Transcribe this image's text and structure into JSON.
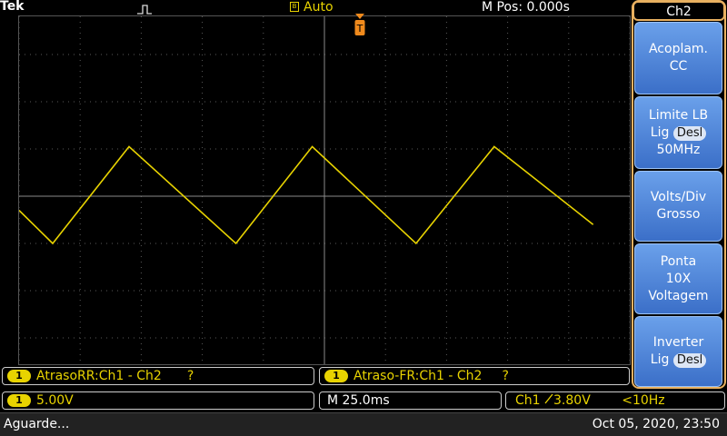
{
  "top_bar": {
    "brand": "Tek",
    "acquisition_mode": "Auto",
    "horizontal_position": "M Pos: 0.000s"
  },
  "side_menu": {
    "title": "Ch2",
    "coupling": {
      "line1": "Acoplam.",
      "line2": "CC"
    },
    "bw_limit": {
      "line1": "Limite LB",
      "line2_label": "Lig",
      "line2_value": "Desl",
      "line3": "50MHz"
    },
    "volts_div": {
      "line1": "Volts/Div",
      "line2": "Grosso"
    },
    "probe": {
      "line1": "Ponta",
      "line2": "10X",
      "line3": "Voltagem"
    },
    "invert": {
      "line1": "Inverter",
      "line2_label": "Lig",
      "line2_value": "Desl"
    }
  },
  "measurements": [
    {
      "channel": "1",
      "label": "AtrasoRR:Ch1 - Ch2",
      "value": "?"
    },
    {
      "channel": "1",
      "label": "Atraso-FR:Ch1 - Ch2",
      "value": "?"
    }
  ],
  "info_bar": {
    "channel": "1",
    "scale": "5.00V",
    "timebase": "M 25.0ms",
    "trigger_source": "Ch1",
    "trigger_slope_icon": "rising-edge-icon",
    "trigger_level": "3.80V",
    "trigger_freq": "<10Hz"
  },
  "status_bar": {
    "status": "Aguarde...",
    "datetime": "Oct 05, 2020, 23:50"
  },
  "colors": {
    "ch1": "#e8d300",
    "menu_accent": "#e8b060",
    "trigger_marker": "#f08a1c",
    "menu_button": "#4a82d8"
  },
  "waveform": {
    "shape": "triangle",
    "channel": "1",
    "vertices_divisions": [
      {
        "t": -5.0,
        "v": -0.3
      },
      {
        "t": -4.45,
        "v": -1.0
      },
      {
        "t": -3.2,
        "v": 1.05
      },
      {
        "t": -1.45,
        "v": -1.0
      },
      {
        "t": -0.2,
        "v": 1.05
      },
      {
        "t": 1.5,
        "v": -1.0
      },
      {
        "t": 2.78,
        "v": 1.05
      },
      {
        "t": 4.4,
        "v": -0.6
      }
    ]
  }
}
